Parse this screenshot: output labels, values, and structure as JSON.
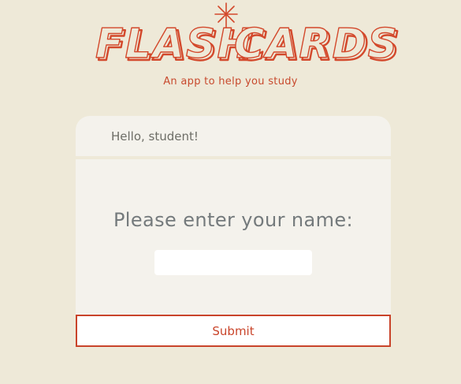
{
  "app": {
    "logo_left": "FLASH",
    "logo_right": "CARDS",
    "tagline": "An app to help you study"
  },
  "card": {
    "greeting": "Hello, student!",
    "prompt": "Please enter your name:"
  },
  "name_input": {
    "value": "",
    "placeholder": ""
  },
  "submit": {
    "label": "Submit"
  },
  "colors": {
    "background": "#eee9d8",
    "card": "#f4f2ec",
    "accent": "#c9442a"
  },
  "icons": {
    "logo_sparkle": "sparkle-icon"
  }
}
